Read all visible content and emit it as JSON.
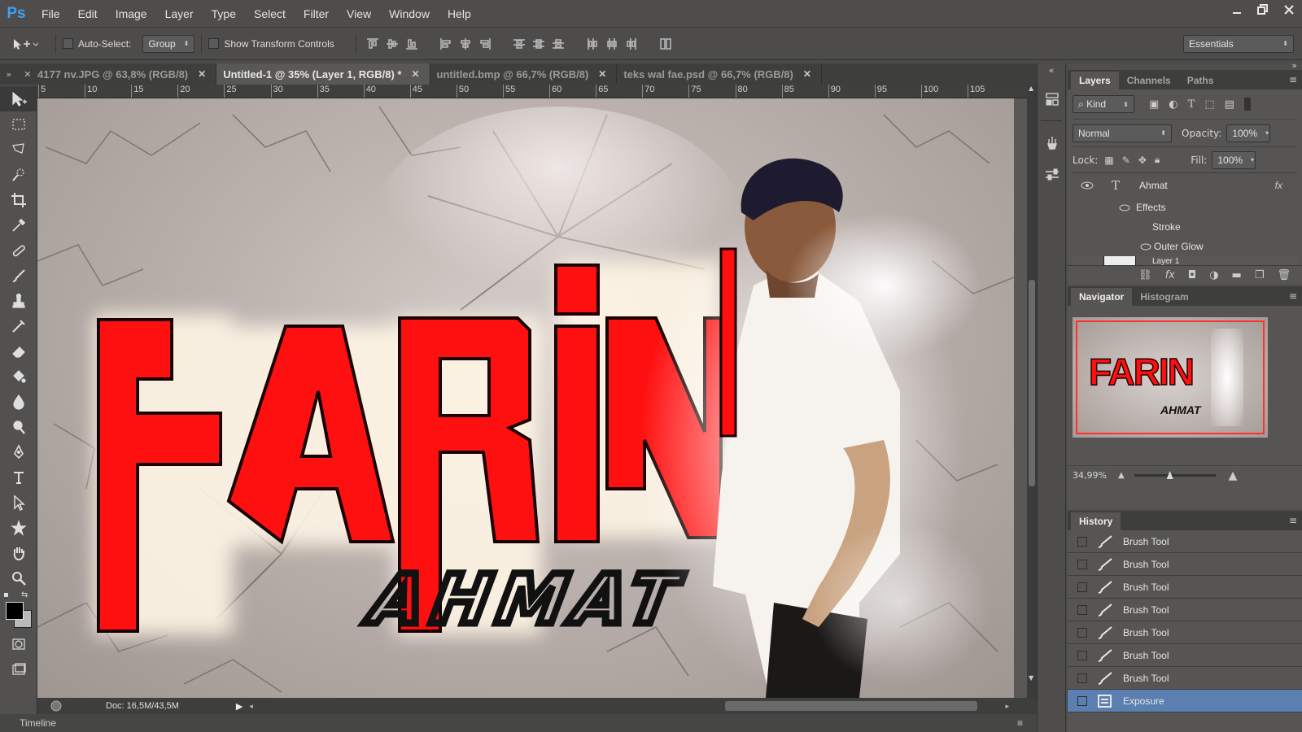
{
  "app": {
    "logo": "Ps"
  },
  "menu": [
    "File",
    "Edit",
    "Image",
    "Layer",
    "Type",
    "Select",
    "Filter",
    "View",
    "Window",
    "Help"
  ],
  "window_controls": [
    "minimize-icon",
    "restore-icon",
    "close-icon"
  ],
  "options": {
    "auto_select_label": "Auto-Select:",
    "auto_select_value": "Group",
    "transform_label": "Show Transform Controls",
    "workspace": "Essentials"
  },
  "tabs": [
    {
      "label": "4177 nv.JPG @ 63,8% (RGB/8)",
      "active": false
    },
    {
      "label": "Untitled-1 @ 35% (Layer 1, RGB/8) *",
      "active": true
    },
    {
      "label": "untitled.bmp @ 66,7% (RGB/8)",
      "active": false
    },
    {
      "label": "teks wal fae.psd @ 66,7% (RGB/8)",
      "active": false
    }
  ],
  "ruler_ticks": [
    "5",
    "10",
    "15",
    "20",
    "25",
    "30",
    "35",
    "40",
    "45",
    "50",
    "55",
    "60",
    "65",
    "70",
    "75",
    "80",
    "85",
    "90",
    "95",
    "100",
    "105"
  ],
  "canvas": {
    "title_text": "FARIN",
    "subtitle_text": "AHMAT",
    "accent_red": "#ff1010",
    "outline": "#1a0000"
  },
  "status": {
    "doc": "Doc: 16,5M/43,5M"
  },
  "timeline_label": "Timeline",
  "layers_panel": {
    "tabs": [
      "Layers",
      "Channels",
      "Paths"
    ],
    "filter_kind": "Kind",
    "blend_mode": "Normal",
    "opacity_label": "Opacity:",
    "opacity_value": "100%",
    "lock_label": "Lock:",
    "fill_label": "Fill:",
    "fill_value": "100%",
    "layer_name": "Ahmat",
    "effects_label": "Effects",
    "stroke_label": "Stroke",
    "outer_glow_label": "Outer Glow",
    "partial_layer": "Layer 1",
    "fx_badge": "fx"
  },
  "navigator_panel": {
    "tabs": [
      "Navigator",
      "Histogram"
    ],
    "zoom": "34,99%",
    "thumb_title": "FARIN",
    "thumb_sub": "AHMAT"
  },
  "history_panel": {
    "title": "History",
    "items": [
      "Brush Tool",
      "Brush Tool",
      "Brush Tool",
      "Brush Tool",
      "Brush Tool",
      "Brush Tool",
      "Brush Tool",
      "Exposure"
    ],
    "current_index": 7
  }
}
